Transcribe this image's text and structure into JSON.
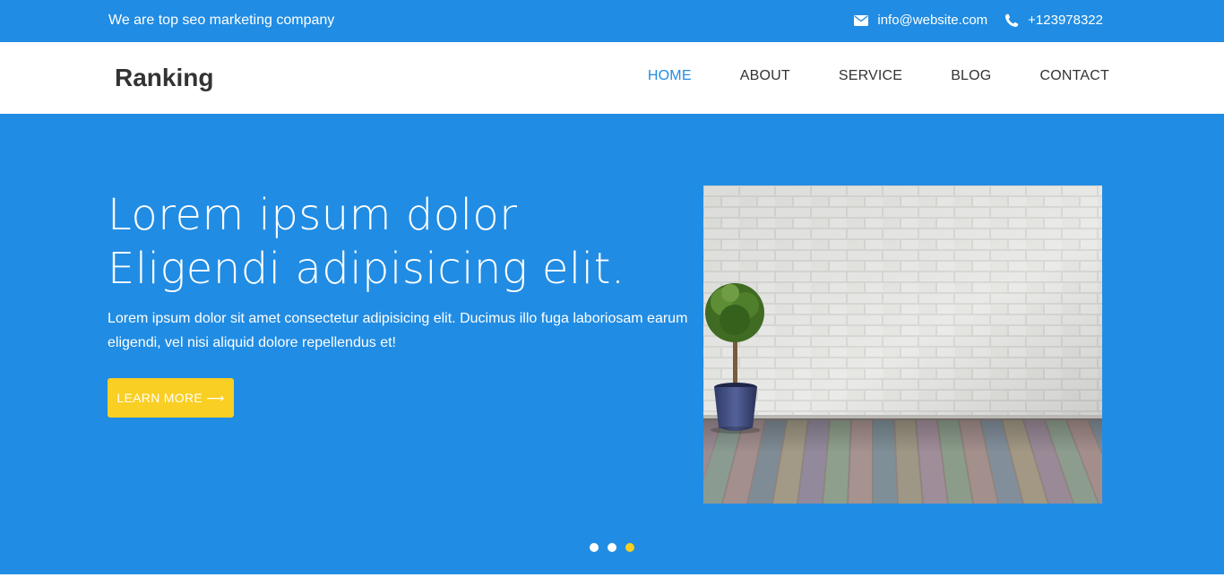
{
  "topbar": {
    "tagline": "We are top seo marketing company",
    "email": "info@website.com",
    "email_icon": "envelope-icon",
    "phone": "+123978322",
    "phone_icon": "phone-icon"
  },
  "navbar": {
    "brand": "Ranking",
    "items": [
      {
        "label": "HOME",
        "active": true
      },
      {
        "label": "ABOUT",
        "active": false
      },
      {
        "label": "SERVICE",
        "active": false
      },
      {
        "label": "BLOG",
        "active": false
      },
      {
        "label": "CONTACT",
        "active": false
      }
    ]
  },
  "hero": {
    "headline_line1": "Lorem ipsum dolor",
    "headline_line2": "Eligendi adipisicing elit.",
    "description": "Lorem ipsum dolor sit amet consectetur adipisicing elit. Ducimus illo fuga laboriosam earum eligendi, vel nisi aliquid dolore repellendus et!",
    "button_label": "LEARN MORE",
    "button_icon": "arrow-right-icon",
    "image_subject": "potted-tree-brick-wall-wood-floor",
    "slider": {
      "count": 3,
      "active_index": 2
    }
  },
  "colors": {
    "primary": "#218ce3",
    "accent": "#f9cf23",
    "text": "#333333",
    "white": "#ffffff"
  }
}
